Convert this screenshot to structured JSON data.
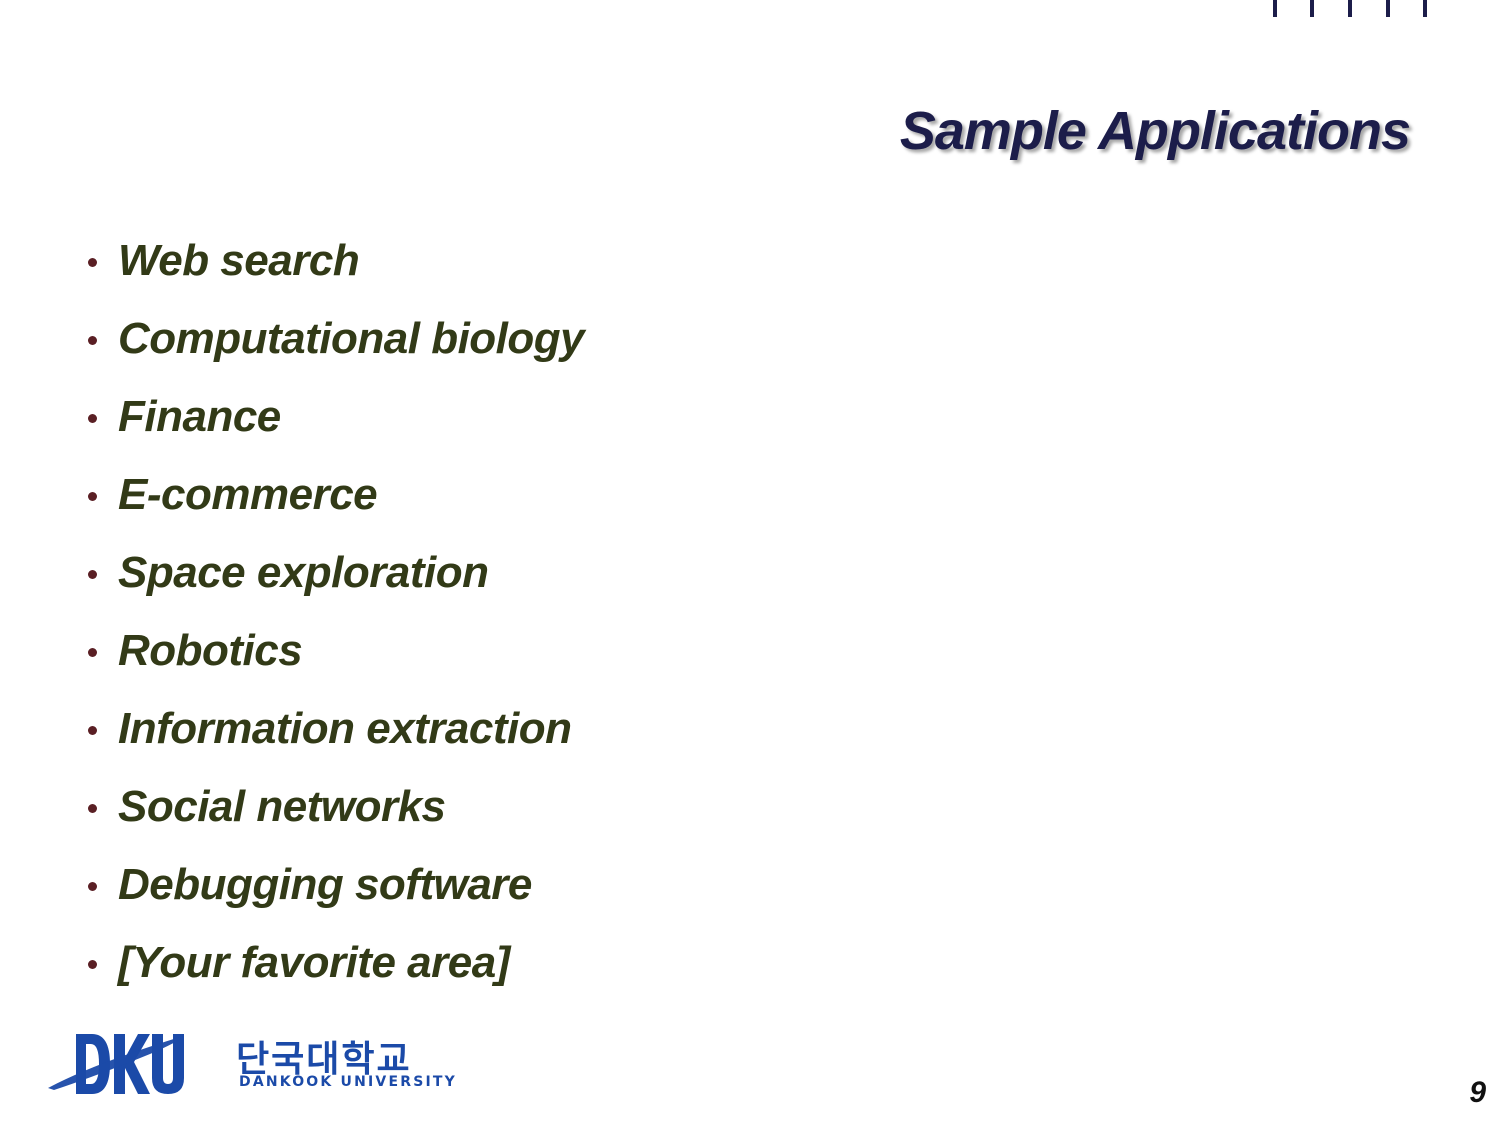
{
  "slide": {
    "title": "Sample Applications",
    "bullets": [
      "Web search",
      "Computational biology",
      "Finance",
      "E-commerce",
      "Space exploration",
      "Robotics",
      "Information extraction",
      "Social networks",
      "Debugging software",
      "[Your favorite area]"
    ],
    "page_number": "9"
  },
  "logo": {
    "korean_name": "단국대학교",
    "english_name": "DANKOOK UNIVERSITY",
    "monogram": "DKU"
  },
  "colors": {
    "title": "#1c1d4a",
    "bullet_text": "#323a17",
    "bullet_dot": "#5a1f24",
    "logo_blue": "#1b4aa8"
  }
}
